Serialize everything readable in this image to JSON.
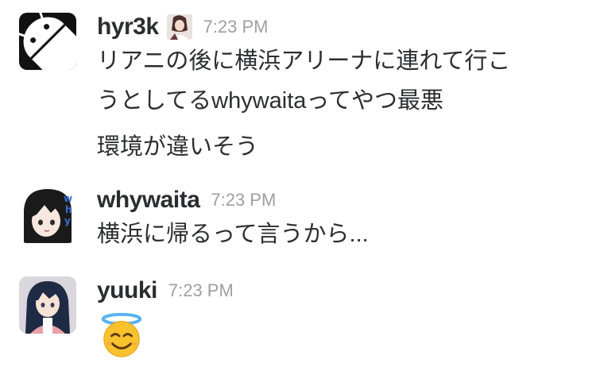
{
  "messages": [
    {
      "username": "hyr3k",
      "timestamp": "7:23 PM",
      "lines": [
        "リアニの後に横浜アリーナに連れて行こ",
        "うとしてるwhywaitaってやつ最悪",
        "環境が違いそう"
      ],
      "avatar_icon": "android-logo-icon",
      "badge_icon": "user-photo-badge"
    },
    {
      "username": "whywaita",
      "timestamp": "7:23 PM",
      "lines": [
        "横浜に帰るって言うから..."
      ],
      "avatar_icon": "anime-character-avatar"
    },
    {
      "username": "yuuki",
      "timestamp": "7:23 PM",
      "lines": [],
      "emoji": "smiling-face-with-halo-emoji",
      "avatar_icon": "anime-character-avatar"
    }
  ],
  "colors": {
    "username": "#2c2d30",
    "timestamp": "#9e9ea6",
    "text": "#2c2d30",
    "android_bg": "#111111"
  }
}
